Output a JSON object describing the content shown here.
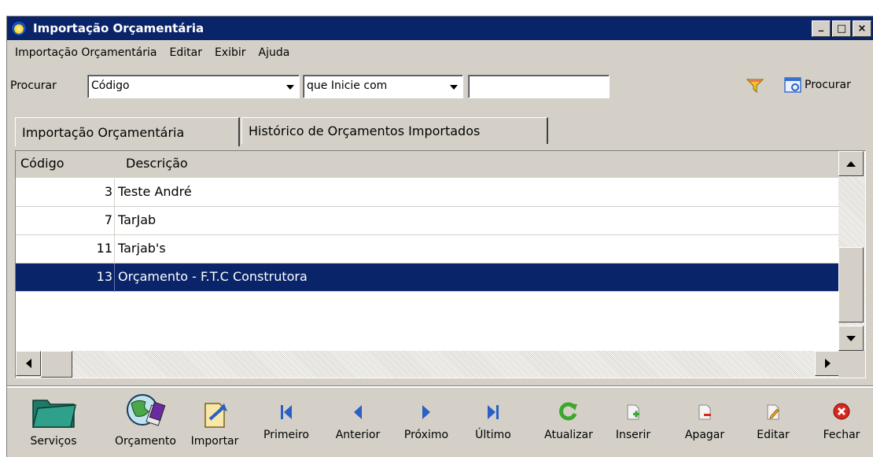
{
  "window": {
    "title": "Importação Orçamentária",
    "controls": [
      "_",
      "□",
      "×"
    ]
  },
  "menu": [
    {
      "label": "Importação Orçamentária"
    },
    {
      "label": "Editar"
    },
    {
      "label": "Exibir"
    },
    {
      "label": "Ajuda"
    }
  ],
  "search": {
    "label": "Procurar",
    "field": "Código",
    "operator": "que Inicie com",
    "value": "",
    "button": "Procurar",
    "filter_icon": "funnel-icon",
    "search_icon": "search-window-icon"
  },
  "tabs": [
    {
      "label": "Importação Orçamentária",
      "active": true
    },
    {
      "label": "Histórico de Orçamentos Importados",
      "active": false
    }
  ],
  "grid": {
    "columns": [
      "Código",
      "Descrição"
    ],
    "rows": [
      {
        "code": "3",
        "desc": "Teste André"
      },
      {
        "code": "7",
        "desc": "TarJab"
      },
      {
        "code": "11",
        "desc": "Tarjab's"
      },
      {
        "code": "13",
        "desc": "Orçamento - F.T.C Construtora",
        "selected": true
      }
    ]
  },
  "toolbar": {
    "servicos": "Serviços",
    "orcamento": "Orçamento",
    "importar": "Importar",
    "primeiro": "Primeiro",
    "anterior": "Anterior",
    "proximo": "Próximo",
    "ultimo": "Último",
    "atualizar": "Atualizar",
    "inserir": "Inserir",
    "apagar": "Apagar",
    "editar": "Editar",
    "fechar": "Fechar"
  },
  "colors": {
    "titlebar": "#0a246a",
    "selection": "#0a246a",
    "face": "#d4d0c8",
    "nav_blue": "#2a5fc4",
    "refresh_green": "#3aa82a",
    "close_red": "#d8281e"
  }
}
